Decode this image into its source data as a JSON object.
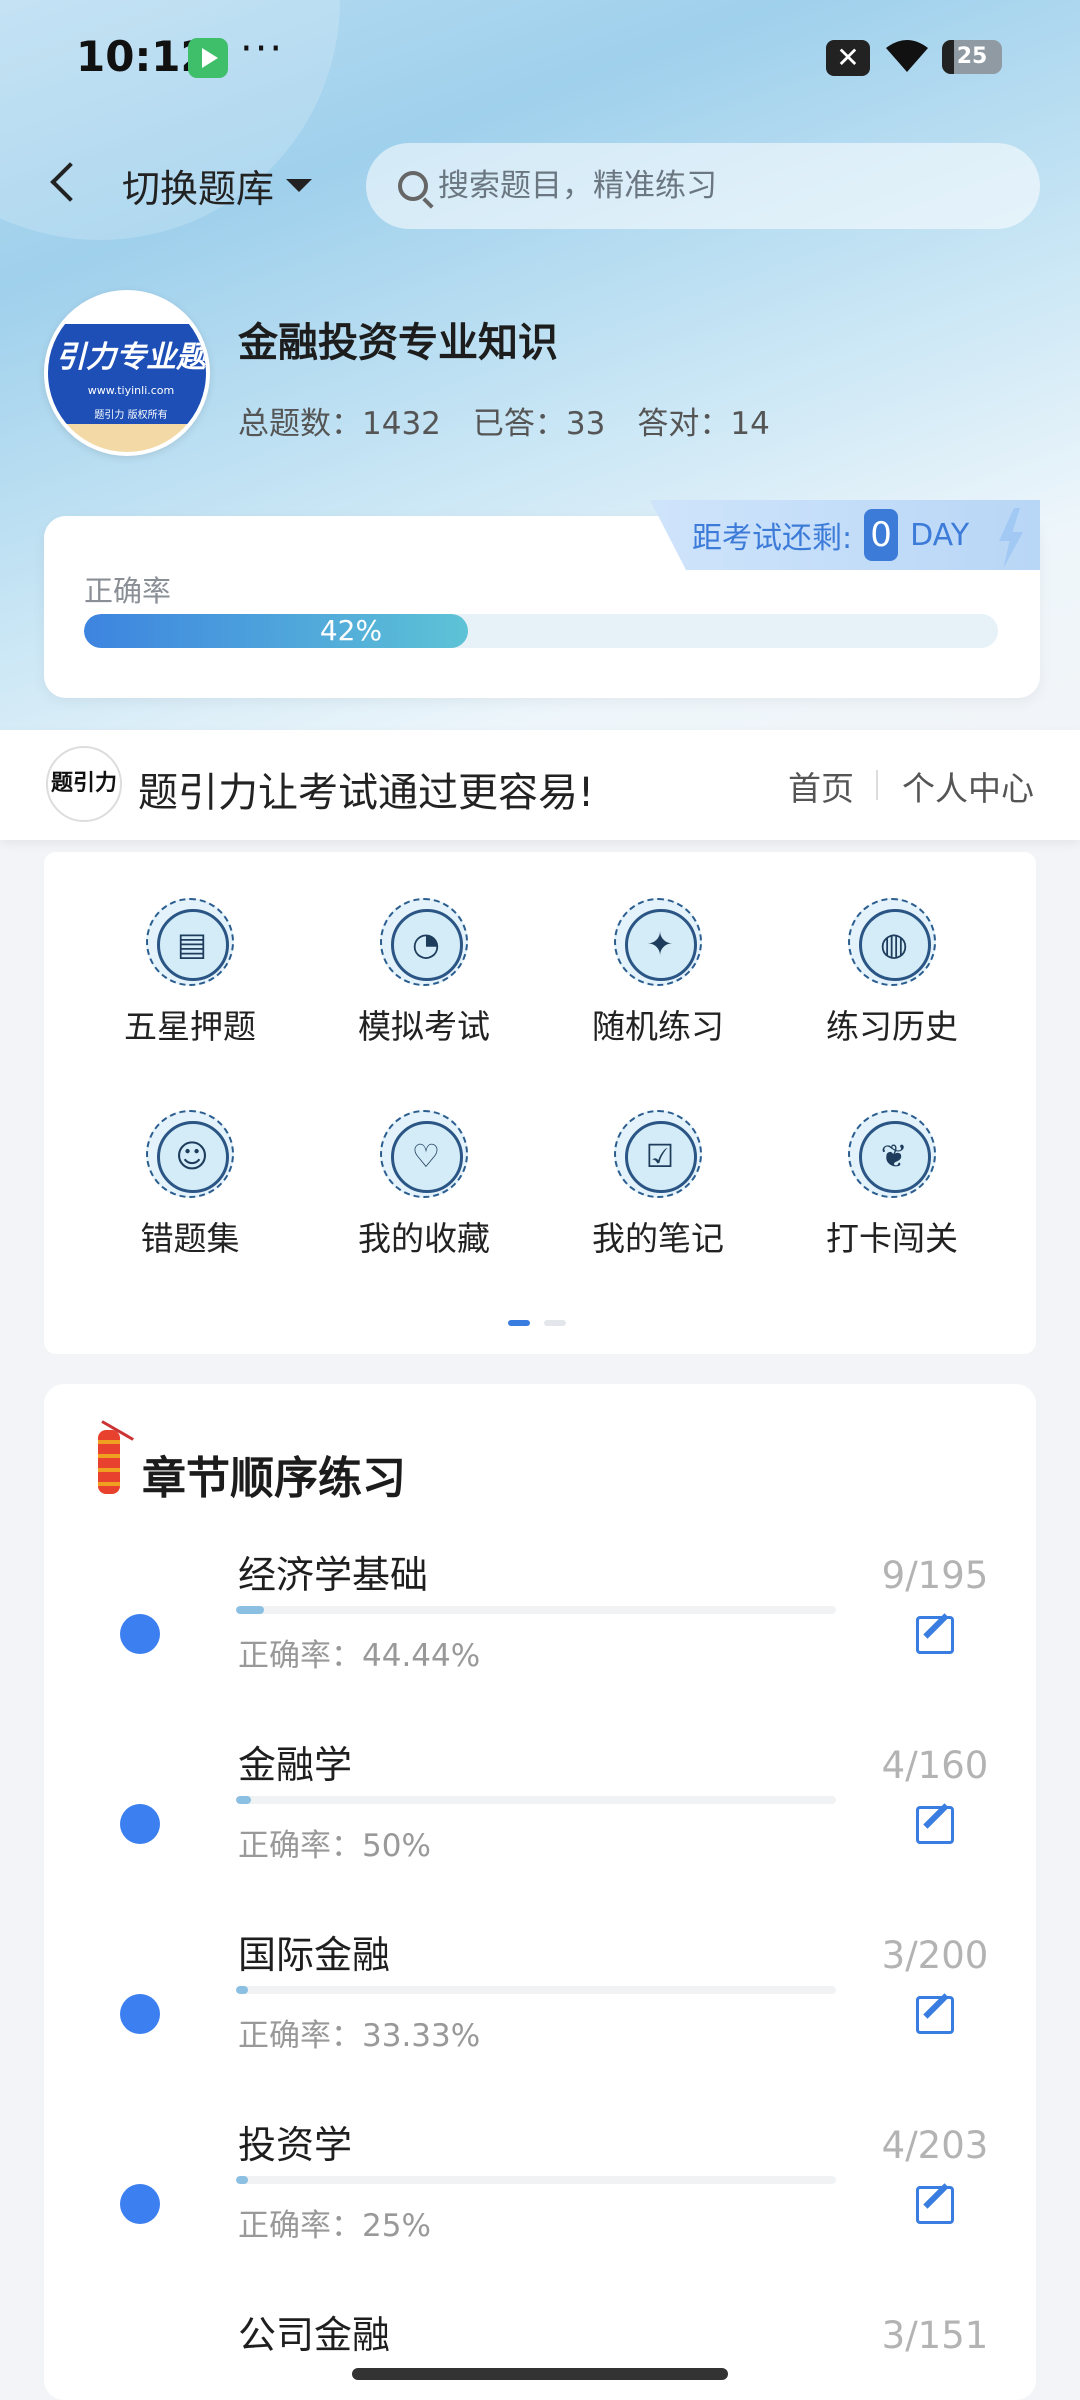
{
  "status_bar": {
    "time": "10:12",
    "dots": "···",
    "battery": "25"
  },
  "header": {
    "switch_label": "切换题库",
    "search_placeholder": "搜索题目，精准练习"
  },
  "bank": {
    "logo_text": "引力专业题",
    "logo_url_text": "www.tiyinli.com",
    "logo_sub": "题引力 版权所有",
    "title": "金融投资专业知识",
    "total_label": "总题数：1432",
    "answered_label": "已答：33",
    "correct_label": "答对：14"
  },
  "accuracy": {
    "label": "正确率",
    "percent": 42,
    "percent_text": "42%"
  },
  "countdown": {
    "label": "距考试还剩:",
    "days": "0",
    "unit": "DAY"
  },
  "slogan": {
    "logo_text": "题引力",
    "text": "题引力让考试通过更容易!",
    "home": "首页",
    "user_center": "个人中心"
  },
  "functions": [
    {
      "label": "五星押题",
      "icon": "id-card-icon"
    },
    {
      "label": "模拟考试",
      "icon": "gauge-icon"
    },
    {
      "label": "随机练习",
      "icon": "shuffle-icon"
    },
    {
      "label": "练习历史",
      "icon": "globe-icon"
    },
    {
      "label": "错题集",
      "icon": "head-icon"
    },
    {
      "label": "我的收藏",
      "icon": "heart-icon"
    },
    {
      "label": "我的笔记",
      "icon": "note-check-icon"
    },
    {
      "label": "打卡闯关",
      "icon": "leaf-icon"
    }
  ],
  "chapters": {
    "title": "章节顺序练习",
    "items": [
      {
        "name": "经济学基础",
        "accuracy": "正确率：44.44%",
        "count": "9/195",
        "progress": 0.046
      },
      {
        "name": "金融学",
        "accuracy": "正确率：50%",
        "count": "4/160",
        "progress": 0.025
      },
      {
        "name": "国际金融",
        "accuracy": "正确率：33.33%",
        "count": "3/200",
        "progress": 0.015
      },
      {
        "name": "投资学",
        "accuracy": "正确率：25%",
        "count": "4/203",
        "progress": 0.02
      },
      {
        "name": "公司金融",
        "accuracy": "",
        "count": "3/151",
        "progress": 0.02
      }
    ]
  }
}
